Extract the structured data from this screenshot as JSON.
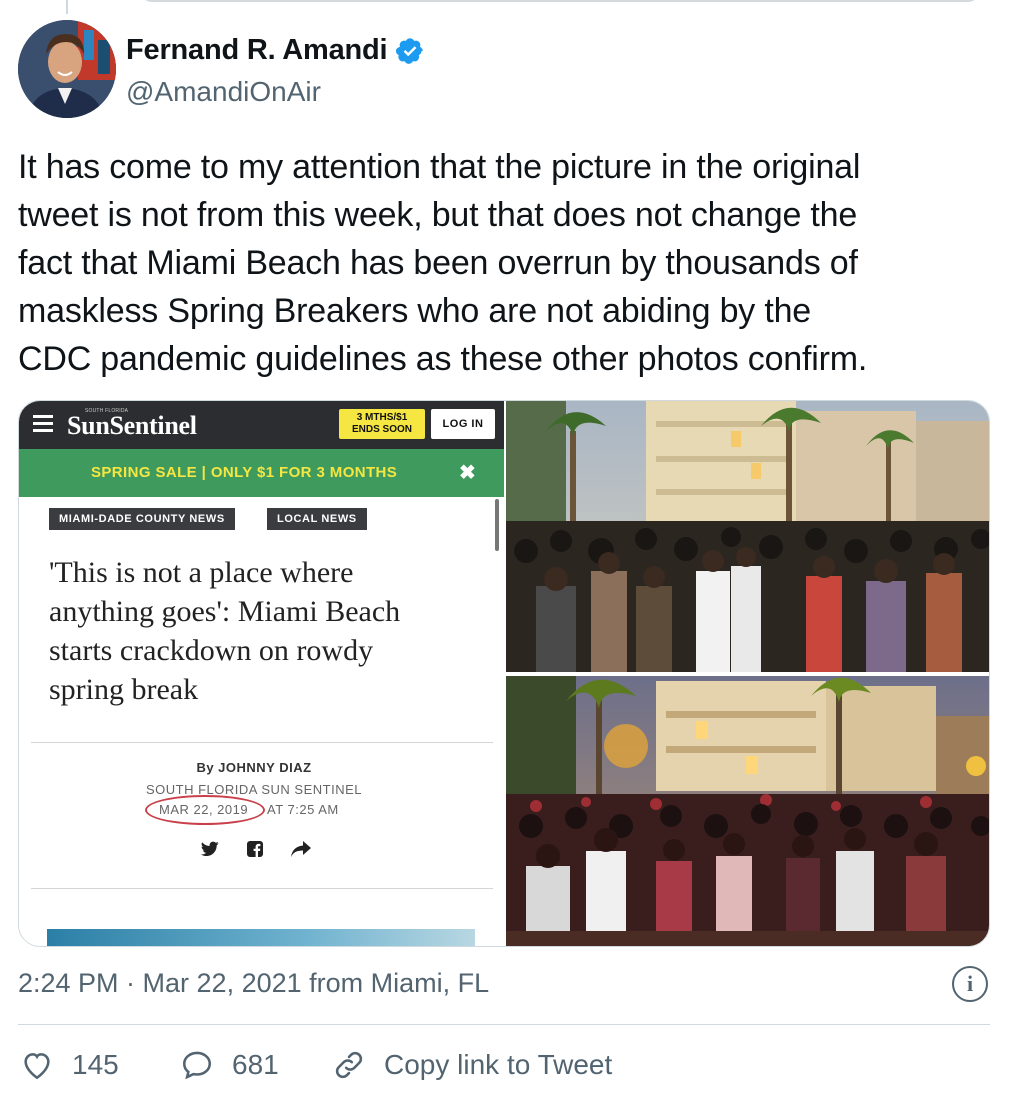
{
  "tweet": {
    "author": {
      "display_name": "Fernand R. Amandi",
      "handle": "@AmandiOnAir",
      "verified": true
    },
    "text_lines": [
      "It has come to my attention that the picture in the original",
      "tweet is not from this week, but that does not change the",
      "fact that Miami Beach has been overrun by thousands of",
      "maskless Spring Breakers who are not abiding by the",
      "CDC pandemic guidelines as these other photos confirm."
    ],
    "timestamp": "2:24 PM · Mar 22, 2021 from Miami, FL",
    "actions": {
      "likes": "145",
      "replies": "681",
      "copy_link_label": "Copy link to Tweet"
    }
  },
  "article_screenshot": {
    "logo": "SunSentinel",
    "logo_kicker": "SOUTH FLORIDA",
    "promo_line1": "3 MTHS/$1",
    "promo_line2": "ENDS SOON",
    "login_label": "LOG IN",
    "sale_banner": "SPRING SALE | ONLY $1 FOR 3 MONTHS",
    "close_glyph": "✖",
    "tags": [
      "MIAMI-DADE COUNTY NEWS",
      "LOCAL NEWS"
    ],
    "headline_lines": [
      "'This is not a place where",
      "anything goes': Miami Beach",
      "starts crackdown on rowdy",
      "spring break"
    ],
    "byline": "By JOHNNY DIAZ",
    "organization": "SOUTH FLORIDA SUN SENTINEL",
    "date": "MAR 22, 2019",
    "time": "AT 7:25 AM",
    "share_icons": [
      "twitter-icon",
      "facebook-icon",
      "share-arrow-icon"
    ]
  },
  "colors": {
    "verified_blue": "#1d9bf0",
    "secondary_text": "#536471",
    "sale_green": "#3f9a5d",
    "promo_yellow": "#f5e642",
    "date_circle_red": "#c9404a"
  }
}
